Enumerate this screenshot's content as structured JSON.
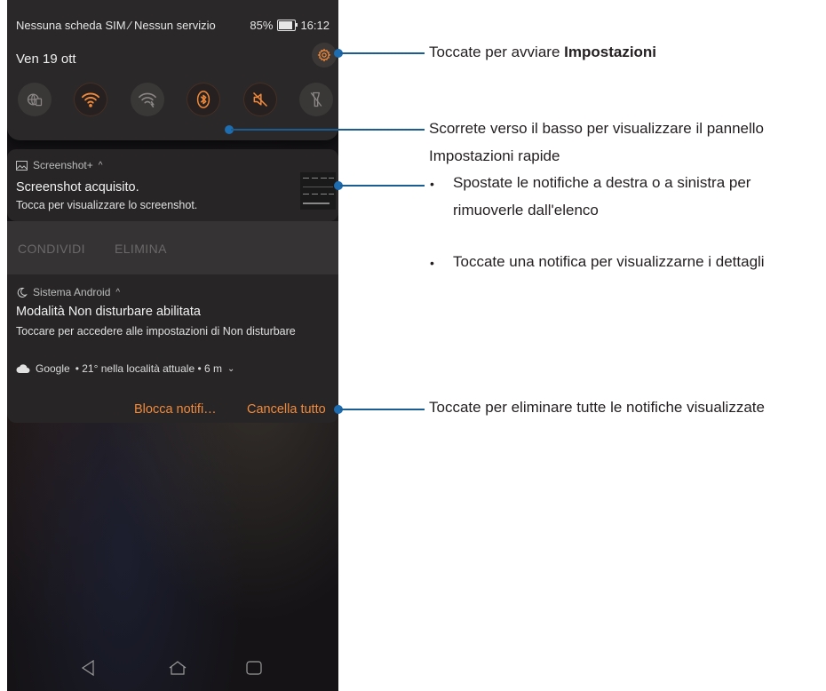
{
  "status_bar": {
    "carrier": "Nessuna scheda SIM ⁄ Nessun servizio",
    "battery": "85%",
    "battery_level": 0.85,
    "time": "16:12"
  },
  "quick_settings": {
    "date": "Ven 19 ott",
    "tiles": [
      {
        "icon": "globe-sim-icon",
        "active": false
      },
      {
        "icon": "wifi-icon",
        "active": true
      },
      {
        "icon": "wifi-calling-icon",
        "active": false
      },
      {
        "icon": "bluetooth-icon",
        "active": true
      },
      {
        "icon": "sound-off-icon",
        "active": true
      },
      {
        "icon": "flashlight-off-icon",
        "active": false
      }
    ]
  },
  "notifications": [
    {
      "app": "Screenshot+",
      "title": "Screenshot acquisito.",
      "text": "Tocca per visualizzare lo screenshot.",
      "actions": [
        "CONDIVIDI",
        "ELIMINA"
      ]
    },
    {
      "app": "Sistema Android",
      "title": "Modalità Non disturbare abilitata",
      "text": "Toccare per accedere alle impostazioni di Non disturbare"
    },
    {
      "app": "Google",
      "text": "• 21° nella località attuale • 6 m"
    }
  ],
  "footer_actions": {
    "block": "Blocca notifi…",
    "clear": "Cancella tutto"
  },
  "annotations": {
    "settings_prefix": "Toccate per avviare ",
    "settings_bold": "Impostazioni",
    "quick_settings_line1": "Scorrete verso il basso per visualizzare il pannello",
    "quick_settings_line2": "Impostazioni rapide",
    "notif_bullet1_line1": "Spostate le notifiche a destra o a sinistra per",
    "notif_bullet1_line2": "rimuoverle dall'elenco",
    "notif_bullet2": "Toccate una notifica per visualizzarne i dettagli",
    "clear_all": "Toccate per eliminare tutte le notifiche visualizzate"
  },
  "colors": {
    "accent": "#F18A3B",
    "callout": "#1E6DB0"
  }
}
